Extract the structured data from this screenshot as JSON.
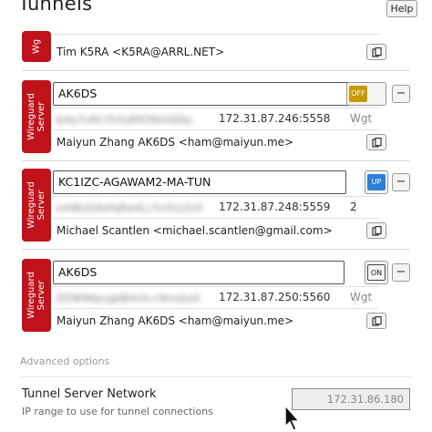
{
  "page": {
    "title": "Tunnels",
    "help_label": "Help"
  },
  "tunnels": [
    {
      "server_label": "Wg",
      "contact": "Tim K5RA <K5RA@ARRL.NET>"
    },
    {
      "server_label": "Wireguard Server",
      "callsign": "AK6DS",
      "state": "OFF",
      "public_key": "Ip4y7u9Cr5rfvjRN3KbG6Dp",
      "endpoint": "172.31.87.246:5558",
      "extra": "Wgt",
      "contact": "Maiyun Zhang AK6DS <ham@maiyun.me>"
    },
    {
      "server_label": "Wireguard Server",
      "callsign": "KC1IZC-AGAWAM2-MA-TUN",
      "state": "UP",
      "public_key": "mH8t2k9sPqRw4Lc7xYb1Zv0",
      "endpoint": "172.31.87.248:5559",
      "extra": "2",
      "contact": "Michael Scantlen <michael.scantlen@gmail.com>"
    },
    {
      "server_label": "Wireguard Server",
      "callsign": "AK6DS",
      "state": "ON",
      "public_key": "ZDlWWlpvgbBHvfx+Nmsbx0",
      "endpoint": "172.31.87.250:5560",
      "extra": "Wgt",
      "contact": "Maiyun Zhang AK6DS <ham@maiyun.me>"
    }
  ],
  "advanced": {
    "label": "Advanced options",
    "network_title": "Tunnel Server Network",
    "network_subtitle": "IP range to use for tunnel connections",
    "network_value": "172.31.86.180"
  },
  "icons": {
    "copy": "clipboard-icon",
    "cursor": "mouse-pointer-icon"
  },
  "colors": {
    "server_tab": "#c0121b",
    "off_state": "#c79a00",
    "up_state": "#2e7fd8"
  }
}
